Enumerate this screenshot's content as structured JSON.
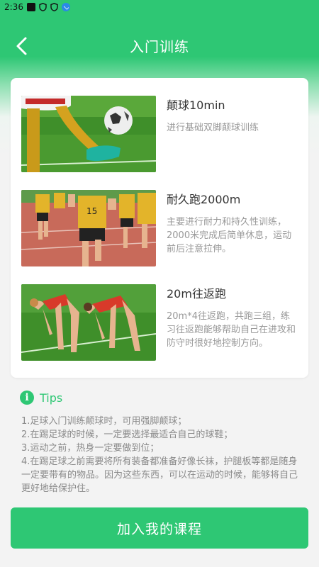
{
  "status_bar": {
    "time": "2:36"
  },
  "header": {
    "title": "入门训练"
  },
  "colors": {
    "accent": "#2ec774",
    "text_primary": "#333333",
    "text_secondary": "#999999"
  },
  "items": [
    {
      "title": "颠球10min",
      "desc": "进行基础双脚颠球训练",
      "image": "soccer-juggling-photo"
    },
    {
      "title": "耐久跑2000m",
      "desc": "主要进行耐力和持久性训练，2000米完成后简单休息，运动前后注意拉伸。",
      "image": "track-running-photo"
    },
    {
      "title": "20m往返跑",
      "desc": "20m*4往返跑，共跑三组，练习往返跑能够帮助自己在进攻和防守时很好地控制方向。",
      "image": "stretching-photo"
    }
  ],
  "tips": {
    "title": "Tips",
    "lines": [
      "1.足球入门训练颠球时，可用强脚颠球；",
      "2.在踢足球的时候，一定要选择最适合自己的球鞋；",
      "3.运动之前，热身一定要做到位；",
      "4.在踢足球之前需要将所有装备都准备好像长袜，护腿板等都是随身一定要带有的物品。因为这些东西，可以在运动的时候，能够将自己更好地给保护住。"
    ]
  },
  "footer": {
    "button_label": "加入我的课程"
  }
}
